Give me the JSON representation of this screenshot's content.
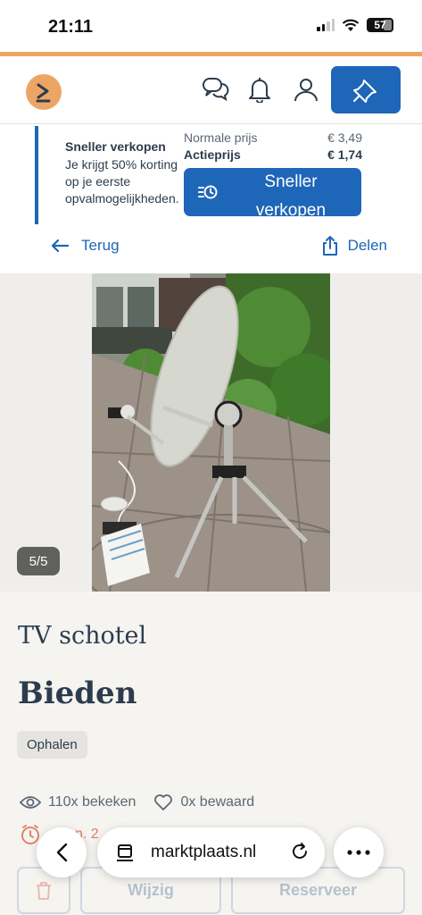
{
  "status_bar": {
    "time": "21:11",
    "battery": "57"
  },
  "header": {
    "logo_icon": "marktplaats-logo-icon",
    "icons": [
      "chat-icon",
      "bell-icon",
      "user-icon",
      "pin-icon"
    ],
    "brand_color": "#1e66b8",
    "accent_color": "#eda566"
  },
  "promo": {
    "title": "Sneller verkopen",
    "text": "Je krijgt 50% korting op je eerste opvalmogelijkheden.",
    "normal_label": "Normale prijs",
    "normal_price": "€ 3,49",
    "action_label": "Actieprijs",
    "action_price": "€ 1,74",
    "button_label": "Sneller verkopen"
  },
  "nav": {
    "back_label": "Terug",
    "share_label": "Delen"
  },
  "gallery": {
    "counter": "5/5"
  },
  "listing": {
    "title": "TV schotel",
    "price": "Bieden",
    "tag": "Ophalen",
    "views": "110x bekeken",
    "saved": "0x bewaard",
    "date_partial": "n. 2"
  },
  "actions": {
    "edit_label": "Wijzig",
    "reserve_label": "Reserveer"
  },
  "browser": {
    "url": "marktplaats.nl"
  }
}
